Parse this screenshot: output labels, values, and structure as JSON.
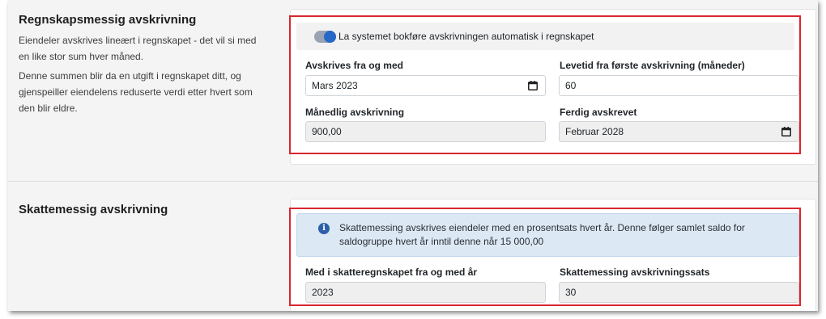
{
  "accounting": {
    "title": "Regnskapsmessig avskrivning",
    "description_1": "Eiendeler avskrives lineært i regnskapet - det vil si med en like stor sum hver måned.",
    "description_2": "Denne summen blir da en utgift i regnskapet ditt, og gjenspeiller eiendelens reduserte verdi etter hvert som den blir eldre.",
    "auto_post_label": "La systemet bokføre avskrivningen automatisk i regnskapet",
    "auto_post_enabled": true,
    "start_label": "Avskrives fra og med",
    "start_value": "Mars 2023",
    "lifetime_label": "Levetid fra første avskrivning (måneder)",
    "lifetime_value": "60",
    "monthly_label": "Månedlig avskrivning",
    "monthly_value": "900,00",
    "end_label": "Ferdig avskrevet",
    "end_value": "Februar 2028"
  },
  "tax": {
    "title": "Skattemessig avskrivning",
    "info_text": "Skattemessing avskrives eiendeler med en prosentsats hvert år. Denne følger samlet saldo for saldogruppe hvert år inntil denne når 15 000,00",
    "year_label": "Med i skatteregnskapet fra og med år",
    "year_value": "2023",
    "rate_label": "Skattemessing avskrivningssats",
    "rate_value": "30"
  },
  "colors": {
    "accent": "#2667c7",
    "highlight": "#d9262f",
    "info_bg": "#dce8f4"
  },
  "icons": {
    "calendar": "calendar-icon",
    "info": "info-icon"
  }
}
